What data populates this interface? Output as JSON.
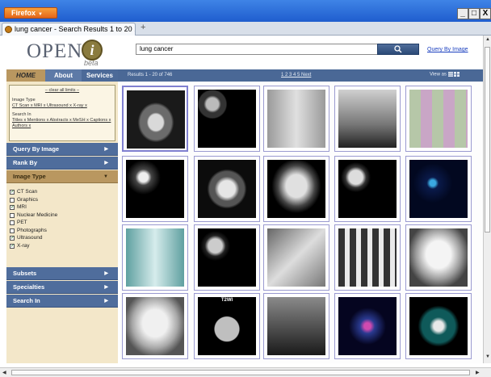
{
  "browser": {
    "menu_button": "Firefox",
    "tab_title": "lung cancer - Search Results 1 to 20 ...",
    "new_tab": "+",
    "window_buttons": [
      "_",
      "□",
      "X"
    ]
  },
  "header": {
    "logo_text": "OPEN",
    "logo_i": "i",
    "logo_beta": "beta",
    "search_value": "lung cancer",
    "search_button_icon": "search-icon",
    "query_by_image_link": "Query By Image"
  },
  "nav": {
    "home": "HOME",
    "about": "About",
    "services": "Services",
    "results_count": "Results 1 - 20 of 746",
    "pager": "1 2 3 4 5 Next",
    "view_as": "View as"
  },
  "sidebar": {
    "clear_limits": "– clear all limits –",
    "image_type_label": "Image Type",
    "image_type_limits": "CT Scan x MRI x Ultrasound x X-ray x",
    "search_in_label": "Search In",
    "search_in_limits": "Titles x Mentions x Abstracts x MeSH x Captions x Authors x",
    "sections": {
      "query_by_image": "Query By Image",
      "rank_by": "Rank By",
      "image_type": "Image Type",
      "subsets": "Subsets",
      "specialties": "Specialties",
      "search_in": "Search In"
    },
    "image_type_options": [
      {
        "label": "CT Scan",
        "checked": true
      },
      {
        "label": "Graphics",
        "checked": false
      },
      {
        "label": "MRI",
        "checked": true
      },
      {
        "label": "Nuclear Medicine",
        "checked": false
      },
      {
        "label": "PET",
        "checked": false
      },
      {
        "label": "Photographs",
        "checked": false
      },
      {
        "label": "Ultrasound",
        "checked": true
      },
      {
        "label": "X-ray",
        "checked": true
      }
    ]
  },
  "results": {
    "thumb_labels": [
      "T2WI"
    ],
    "thumbnails": [
      "ct-chest-axial",
      "ct-chest-grid",
      "xray-chest-composite",
      "xray-chest-multi",
      "histology-grid",
      "nuclear-medicine-grid",
      "ct-chest-axial-2",
      "xray-chest-framed",
      "mri-brain-grid",
      "fluorescence-microscopy",
      "xray-chest-cyan",
      "ct-brain-grid",
      "xray-composite",
      "xray-skeleton-grid",
      "xray-chest-2",
      "xray-chest-3",
      "diagram-t2wi",
      "xray-multi-panel",
      "mri-composite-color",
      "ct-chest-dark"
    ]
  },
  "colors": {
    "titlebar": "#1f5dce",
    "firefox_button": "#e3661a",
    "navbar": "#4a6896",
    "home_tab": "#b99760",
    "sidebar_bg": "#f3e7c9",
    "sidebar_headers": "#4f6d9c",
    "link": "#1a3fbf"
  }
}
